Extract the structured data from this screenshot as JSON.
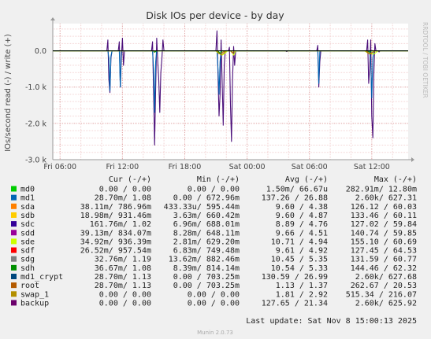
{
  "chart_data": {
    "type": "line",
    "title": "Disk IOs per device - by day",
    "ylabel": "IOs/second read (-) / write (+)",
    "watermark": "RRDTOOL / TOBI OETIKER",
    "y_ticks": [
      {
        "value": 0,
        "label": "0.0"
      },
      {
        "value": -1000,
        "label": "-1.0 k"
      },
      {
        "value": -2000,
        "label": "-2.0 k"
      },
      {
        "value": -3000,
        "label": "-3.0 k"
      }
    ],
    "ylim": [
      -3000,
      750
    ],
    "x_ticks": [
      {
        "value": 6,
        "label": "Fri 06:00"
      },
      {
        "value": 12,
        "label": "Fri 12:00"
      },
      {
        "value": 18,
        "label": "Fri 18:00"
      },
      {
        "value": 24,
        "label": "Sat 00:00"
      },
      {
        "value": 30,
        "label": "Sat 06:00"
      },
      {
        "value": 36,
        "label": "Sat 12:00"
      }
    ],
    "xlim": [
      5.3,
      39.5
    ],
    "series": [
      {
        "name": "backup",
        "color": "#4b0f7a",
        "points": [
          [
            5.3,
            0
          ],
          [
            10.5,
            0
          ],
          [
            10.6,
            300
          ],
          [
            10.7,
            -800
          ],
          [
            10.8,
            -1150
          ],
          [
            10.9,
            -200
          ],
          [
            11.0,
            0
          ],
          [
            11.6,
            0
          ],
          [
            11.7,
            250
          ],
          [
            11.8,
            -1000
          ],
          [
            11.9,
            -200
          ],
          [
            12.0,
            350
          ],
          [
            12.1,
            -400
          ],
          [
            12.2,
            0
          ],
          [
            14.8,
            0
          ],
          [
            14.9,
            250
          ],
          [
            15.0,
            -1100
          ],
          [
            15.1,
            -2600
          ],
          [
            15.2,
            -1000
          ],
          [
            15.3,
            350
          ],
          [
            15.4,
            -300
          ],
          [
            15.5,
            -800
          ],
          [
            15.6,
            -1700
          ],
          [
            15.7,
            -600
          ],
          [
            15.8,
            -200
          ],
          [
            15.9,
            300
          ],
          [
            16.0,
            0
          ],
          [
            21.0,
            0
          ],
          [
            21.1,
            550
          ],
          [
            21.2,
            -700
          ],
          [
            21.3,
            -1800
          ],
          [
            21.4,
            -1200
          ],
          [
            21.5,
            300
          ],
          [
            21.6,
            -900
          ],
          [
            21.7,
            -2050
          ],
          [
            21.8,
            -400
          ],
          [
            21.9,
            0
          ],
          [
            22.2,
            0
          ],
          [
            22.3,
            100
          ],
          [
            22.4,
            -1500
          ],
          [
            22.5,
            -2500
          ],
          [
            22.6,
            -800
          ],
          [
            22.7,
            120
          ],
          [
            22.8,
            -400
          ],
          [
            22.9,
            0
          ],
          [
            27.7,
            0
          ],
          [
            27.8,
            -20
          ],
          [
            28.0,
            0
          ],
          [
            30.7,
            0
          ],
          [
            30.8,
            150
          ],
          [
            30.9,
            -1000
          ],
          [
            31.0,
            -300
          ],
          [
            31.1,
            0
          ],
          [
            35.5,
            0
          ],
          [
            35.6,
            300
          ],
          [
            35.7,
            -900
          ],
          [
            35.8,
            -500
          ],
          [
            35.9,
            300
          ],
          [
            36.0,
            -1800
          ],
          [
            36.1,
            -2400
          ],
          [
            36.2,
            -600
          ],
          [
            36.3,
            200
          ],
          [
            36.4,
            0
          ],
          [
            36.6,
            0
          ],
          [
            36.7,
            -30
          ],
          [
            36.8,
            0
          ],
          [
            39.5,
            0
          ]
        ]
      },
      {
        "name": "sda",
        "color": "#0066b3",
        "points": [
          [
            5.3,
            0
          ],
          [
            10.6,
            0
          ],
          [
            10.7,
            -200
          ],
          [
            10.8,
            -1100
          ],
          [
            10.9,
            -150
          ],
          [
            11.0,
            0
          ],
          [
            11.7,
            0
          ],
          [
            11.8,
            -1000
          ],
          [
            11.9,
            0
          ],
          [
            14.9,
            0
          ],
          [
            15.0,
            -500
          ],
          [
            15.1,
            -1700
          ],
          [
            15.2,
            -300
          ],
          [
            15.3,
            0
          ],
          [
            21.1,
            0
          ],
          [
            21.2,
            -500
          ],
          [
            21.3,
            -1200
          ],
          [
            21.4,
            -300
          ],
          [
            21.5,
            0
          ],
          [
            30.8,
            0
          ],
          [
            30.9,
            -900
          ],
          [
            31.0,
            0
          ],
          [
            35.8,
            0
          ],
          [
            35.9,
            -300
          ],
          [
            36.0,
            -1300
          ],
          [
            36.1,
            -200
          ],
          [
            36.2,
            0
          ],
          [
            39.5,
            0
          ]
        ]
      },
      {
        "name": "sde",
        "color": "#ccff00",
        "points": [
          [
            5.3,
            0
          ],
          [
            21.0,
            0
          ],
          [
            21.2,
            -60
          ],
          [
            21.6,
            -120
          ],
          [
            21.9,
            -60
          ],
          [
            22.1,
            0
          ],
          [
            22.5,
            0
          ],
          [
            22.7,
            -120
          ],
          [
            22.9,
            0
          ],
          [
            35.3,
            0
          ],
          [
            35.7,
            -70
          ],
          [
            36.2,
            -90
          ],
          [
            36.6,
            0
          ],
          [
            39.5,
            0
          ]
        ]
      },
      {
        "name": "root",
        "color": "#b35a00",
        "points": [
          [
            5.3,
            0
          ],
          [
            21.1,
            0
          ],
          [
            21.3,
            -80
          ],
          [
            21.7,
            -30
          ],
          [
            22.0,
            0
          ],
          [
            22.4,
            0
          ],
          [
            22.6,
            -60
          ],
          [
            22.8,
            0
          ],
          [
            35.5,
            0
          ],
          [
            35.8,
            -90
          ],
          [
            36.1,
            -30
          ],
          [
            36.4,
            0
          ],
          [
            39.5,
            0
          ]
        ]
      },
      {
        "name": "swap_1",
        "color": "#b38f00",
        "points": [
          [
            5.3,
            0
          ],
          [
            21.0,
            0
          ],
          [
            21.2,
            -40
          ],
          [
            21.5,
            -110
          ],
          [
            21.8,
            -50
          ],
          [
            22.0,
            0
          ],
          [
            35.4,
            0
          ],
          [
            35.6,
            -60
          ],
          [
            35.9,
            -80
          ],
          [
            36.3,
            0
          ],
          [
            39.5,
            0
          ]
        ]
      },
      {
        "name": "sdh",
        "color": "#008f00",
        "points": [
          [
            5.3,
            0
          ],
          [
            15.0,
            0
          ],
          [
            15.1,
            -40
          ],
          [
            15.3,
            0
          ],
          [
            21.2,
            0
          ],
          [
            21.4,
            -70
          ],
          [
            21.6,
            0
          ],
          [
            35.6,
            0
          ],
          [
            35.8,
            -40
          ],
          [
            36.0,
            0
          ],
          [
            39.5,
            0
          ]
        ]
      }
    ],
    "legend": {
      "headers": [
        "Cur (-/+)",
        "Min (-/+)",
        "Avg (-/+)",
        "Max (-/+)"
      ],
      "rows": [
        {
          "name": "md0",
          "color": "#00cc00",
          "cur": "0.00 /   0.00",
          "min": "0.00 /   0.00",
          "avg": "1.50m/  66.67u",
          "max": "282.91m/  12.80m"
        },
        {
          "name": "md1",
          "color": "#0066b3",
          "cur": "28.70m/   1.08",
          "min": "0.00 / 672.96m",
          "avg": "137.26 /  26.88",
          "max": "2.60k/ 627.31"
        },
        {
          "name": "sda",
          "color": "#ff8000",
          "cur": "38.11m/ 786.96m",
          "min": "433.33u/ 595.44m",
          "avg": "9.60 /   4.38",
          "max": "126.12 /  60.03"
        },
        {
          "name": "sdb",
          "color": "#ffcc00",
          "cur": "18.98m/ 931.46m",
          "min": "3.63m/ 660.42m",
          "avg": "9.60 /   4.87",
          "max": "133.46 /  60.11"
        },
        {
          "name": "sdc",
          "color": "#330099",
          "cur": "161.76m/   1.02",
          "min": "6.96m/ 688.01m",
          "avg": "8.89 /   4.76",
          "max": "127.02 /  59.84"
        },
        {
          "name": "sdd",
          "color": "#990099",
          "cur": "39.13m/ 834.07m",
          "min": "8.28m/ 648.11m",
          "avg": "9.66 /   4.51",
          "max": "140.74 /  59.85"
        },
        {
          "name": "sde",
          "color": "#ccff00",
          "cur": "34.92m/ 936.39m",
          "min": "2.81m/ 629.20m",
          "avg": "10.71 /   4.94",
          "max": "155.10 /  60.69"
        },
        {
          "name": "sdf",
          "color": "#ff0000",
          "cur": "26.52m/ 957.54m",
          "min": "6.83m/ 749.48m",
          "avg": "9.61 /   4.92",
          "max": "127.45 /  64.53"
        },
        {
          "name": "sdg",
          "color": "#808080",
          "cur": "32.76m/   1.19",
          "min": "13.62m/ 882.46m",
          "avg": "10.45 /   5.35",
          "max": "131.59 /  60.77"
        },
        {
          "name": "sdh",
          "color": "#008f00",
          "cur": "36.67m/   1.08",
          "min": "8.39m/ 814.14m",
          "avg": "10.54 /   5.33",
          "max": "144.46 /  62.32"
        },
        {
          "name": "md1_crypt",
          "color": "#00487d",
          "cur": "28.70m/   1.13",
          "min": "0.00 / 703.25m",
          "avg": "130.59 /  26.99",
          "max": "2.60k/ 627.68"
        },
        {
          "name": "root",
          "color": "#b35a00",
          "cur": "28.70m/   1.13",
          "min": "0.00 / 703.25m",
          "avg": "1.13 /   1.37",
          "max": "262.67 /  20.53"
        },
        {
          "name": "swap_1",
          "color": "#b38f00",
          "cur": "0.00 /   0.00",
          "min": "0.00 /   0.00",
          "avg": "1.81 /   2.92",
          "max": "515.34 / 216.07"
        },
        {
          "name": "backup",
          "color": "#6b006b",
          "cur": "0.00 /   0.00",
          "min": "0.00 /   0.00",
          "avg": "127.65 /  21.34",
          "max": "2.60k/ 625.92"
        }
      ]
    },
    "last_update": "Last update: Sat Nov  8 15:00:13 2025",
    "footer": "Munin 2.0.73"
  }
}
